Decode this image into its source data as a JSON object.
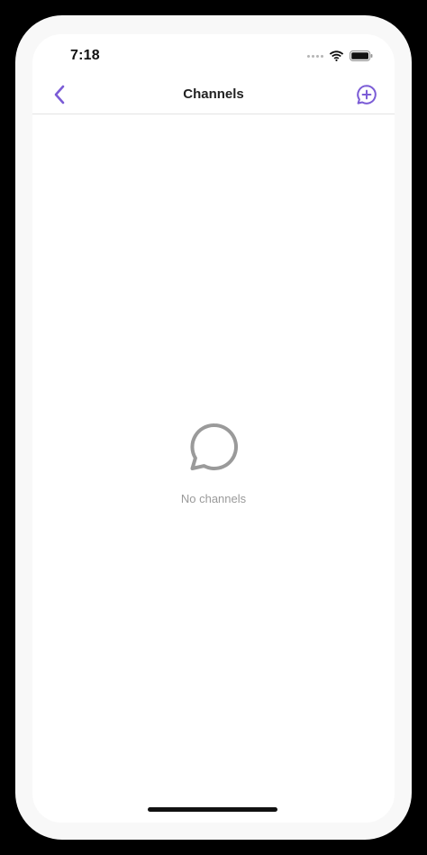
{
  "status_bar": {
    "time": "7:18",
    "icons": [
      "signal-dots-icon",
      "wifi-icon",
      "battery-icon"
    ]
  },
  "nav": {
    "title": "Channels",
    "back_icon": "chevron-left-icon",
    "new_channel_icon": "chat-plus-icon"
  },
  "empty_state": {
    "icon": "chat-bubble-icon",
    "message": "No channels"
  },
  "colors": {
    "accent": "#7b5cd6",
    "empty_icon": "#9a9a9a",
    "empty_text": "#9a9a9a",
    "title_text": "#222222",
    "divider": "#e4e4e4",
    "background": "#ffffff"
  }
}
